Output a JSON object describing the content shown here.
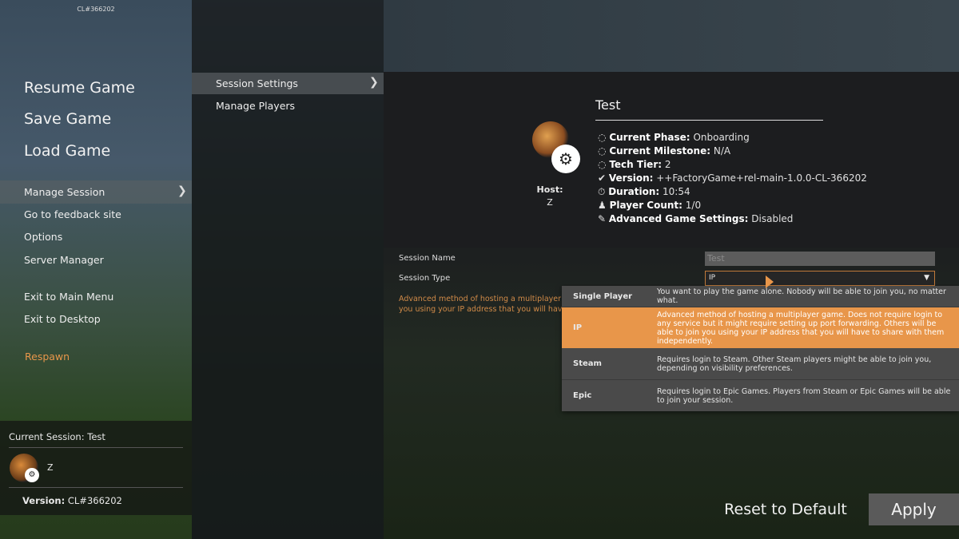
{
  "build": "CL#366202",
  "left_menu": {
    "primary": [
      "Resume Game",
      "Save Game",
      "Load Game"
    ],
    "secondary": [
      "Manage Session",
      "Go to feedback site",
      "Options",
      "Server Manager"
    ],
    "exit": [
      "Exit to Main Menu",
      "Exit to Desktop"
    ],
    "respawn": "Respawn"
  },
  "current_session": {
    "label": "Current Session: Test",
    "player": "Z",
    "version_label": "Version:",
    "version_value": "CL#366202"
  },
  "sub_menu": [
    "Session Settings",
    "Manage Players"
  ],
  "session": {
    "title": "Test",
    "host_label": "Host:",
    "host": "Z",
    "rows": [
      {
        "icon": "dashed-circle-icon",
        "label": "Current Phase:",
        "value": "Onboarding"
      },
      {
        "icon": "dashed-circle-icon",
        "label": "Current Milestone:",
        "value": "N/A"
      },
      {
        "icon": "dashed-circle-icon",
        "label": "Tech Tier:",
        "value": "2"
      },
      {
        "icon": "check-icon",
        "label": "Version:",
        "value": "++FactoryGame+rel-main-1.0.0-CL-366202"
      },
      {
        "icon": "stopwatch-icon",
        "label": "Duration:",
        "value": "10:54"
      },
      {
        "icon": "players-icon",
        "label": "Player Count:",
        "value": "1/0"
      },
      {
        "icon": "pencil-icon",
        "label": "Advanced Game Settings:",
        "value": "Disabled"
      }
    ]
  },
  "form": {
    "name_label": "Session Name",
    "name_value": "Test",
    "type_label": "Session Type",
    "type_value": "IP",
    "desc_line1": "Advanced method of hosting a multiplayer gam",
    "desc_line2": "you using your IP address that you will have to"
  },
  "dropdown": [
    {
      "name": "Single Player",
      "desc": "You want to play the game alone. Nobody will be able to join you, no matter what."
    },
    {
      "name": "IP",
      "desc": "Advanced method of hosting a multiplayer game. Does not require login to any service but it might require setting up port forwarding. Others will be able to join you using your IP address that you will have to share with them independently.",
      "selected": true
    },
    {
      "name": "Steam",
      "desc": "Requires login to Steam. Other Steam players might be able to join you, depending on visibility preferences."
    },
    {
      "name": "Epic",
      "desc": "Requires login to Epic Games. Players from Steam or Epic Games will be able to join your session."
    }
  ],
  "buttons": {
    "reset": "Reset to Default",
    "apply": "Apply"
  },
  "colors": {
    "accent": "#e8964a",
    "apply_bg": "#5a5a5a"
  }
}
